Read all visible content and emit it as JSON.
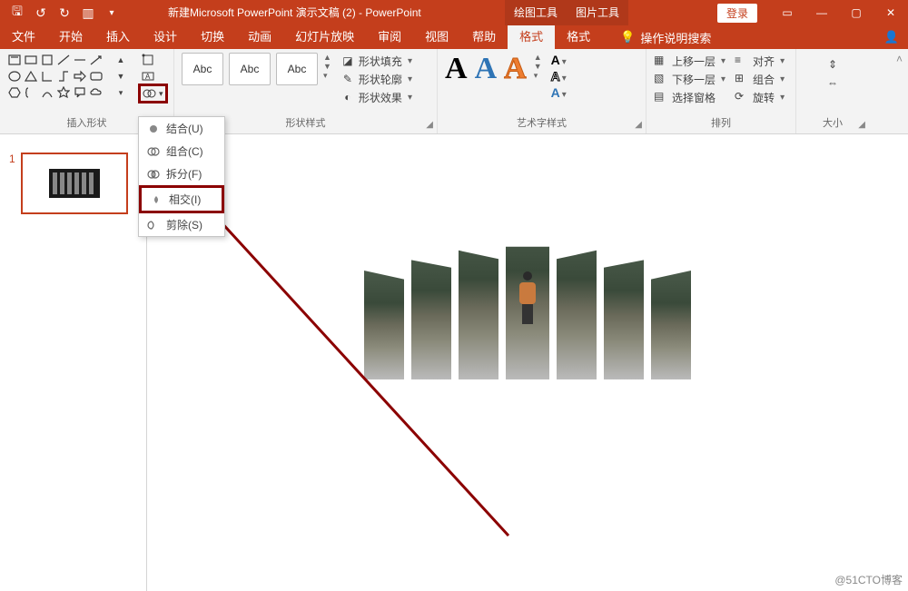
{
  "titlebar": {
    "doc_title": "新建Microsoft PowerPoint 演示文稿 (2)  -  PowerPoint",
    "tool_tab1": "绘图工具",
    "tool_tab2": "图片工具",
    "login": "登录"
  },
  "menu": {
    "tabs": [
      "文件",
      "开始",
      "插入",
      "设计",
      "切换",
      "动画",
      "幻灯片放映",
      "审阅",
      "视图",
      "帮助",
      "格式",
      "格式"
    ],
    "active_index": 10,
    "search_placeholder": "操作说明搜索"
  },
  "ribbon": {
    "group_insert_shapes": "插入形状",
    "group_shape_styles": "形状样式",
    "group_wordart": "艺术字样式",
    "group_arrange": "排列",
    "group_size": "大小",
    "style_sample": "Abc",
    "shape_fill": "形状填充",
    "shape_outline": "形状轮廓",
    "shape_effects": "形状效果",
    "bring_forward": "上移一层",
    "send_backward": "下移一层",
    "selection_pane": "选择窗格",
    "align": "对齐",
    "group": "组合",
    "rotate": "旋转"
  },
  "merge_menu": {
    "items": [
      {
        "label": "结合(U)",
        "icon": "union"
      },
      {
        "label": "组合(C)",
        "icon": "combine"
      },
      {
        "label": "拆分(F)",
        "icon": "fragment"
      },
      {
        "label": "相交(I)",
        "icon": "intersect"
      },
      {
        "label": "剪除(S)",
        "icon": "subtract"
      }
    ],
    "highlight_index": 3
  },
  "thumbs": {
    "slide1_num": "1"
  },
  "watermark": "@51CTO博客",
  "colors": {
    "accent": "#C43E1C",
    "highlight": "#8B0000"
  }
}
